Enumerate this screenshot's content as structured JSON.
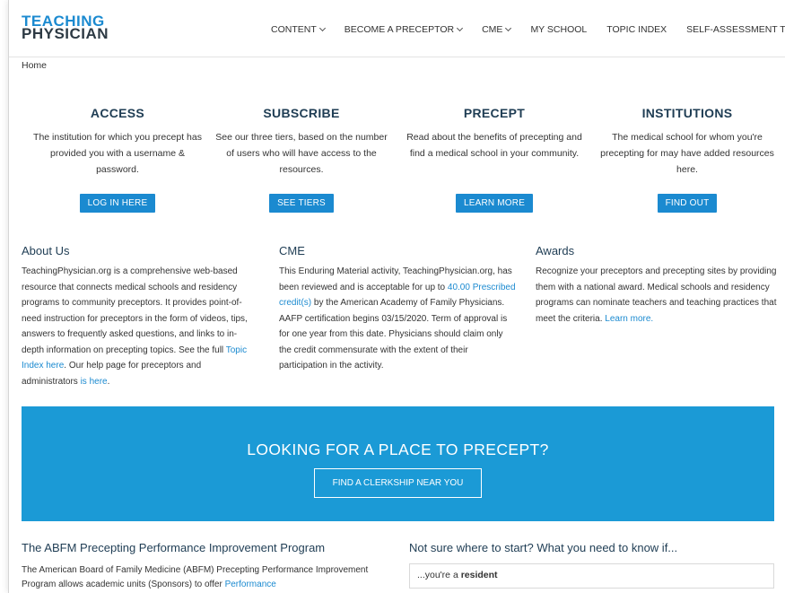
{
  "logo": {
    "line1": "TEACHING",
    "line2": "PHYSICIAN"
  },
  "nav": {
    "items": [
      {
        "label": "CONTENT",
        "dropdown": true
      },
      {
        "label": "BECOME A PRECEPTOR",
        "dropdown": true
      },
      {
        "label": "CME",
        "dropdown": true
      },
      {
        "label": "MY SCHOOL",
        "dropdown": false
      },
      {
        "label": "TOPIC INDEX",
        "dropdown": false
      },
      {
        "label": "SELF-ASSESSMENT TOOL",
        "dropdown": false
      }
    ]
  },
  "breadcrumb": "Home",
  "features": [
    {
      "title": "ACCESS",
      "text": "The institution for which you precept has provided you with a username & password.",
      "button": "LOG IN HERE"
    },
    {
      "title": "SUBSCRIBE",
      "text": "See our three tiers, based on the number of users who will have access to the resources.",
      "button": "SEE TIERS"
    },
    {
      "title": "PRECEPT",
      "text": "Read about the benefits of precepting and find a medical school in your community.",
      "button": "LEARN MORE"
    },
    {
      "title": "INSTITUTIONS",
      "text": "The medical school for whom you're precepting for may have added resources here.",
      "button": "FIND OUT"
    }
  ],
  "about": {
    "title": "About Us",
    "text1": "TeachingPhysician.org is a comprehensive web-based resource that connects medical schools and residency programs to community preceptors. It provides point-of-need instruction for preceptors in the form of videos, tips, answers to frequently asked questions, and links to in-depth information on precepting topics. See the full ",
    "link1": "Topic Index here",
    "text2": ". Our help page for preceptors and administrators ",
    "link2": "is here",
    "text3": "."
  },
  "cme": {
    "title": "CME",
    "text1": "This Enduring Material activity, TeachingPhysician.org, has been reviewed and is acceptable for up to ",
    "link1": "40.00 Prescribed credit(s)",
    "text2": " by the American Academy of Family Physicians. AAFP certification begins 03/15/2020. Term of approval is for one year from this date. Physicians should claim only the credit commensurate with the extent of their participation in the activity."
  },
  "awards": {
    "title": "Awards",
    "text1": "Recognize your preceptors and precepting sites by providing them with a national award. Medical schools and residency programs can nominate teachers and teaching practices that meet the criteria. ",
    "link1": "Learn more."
  },
  "banner": {
    "title": "LOOKING FOR A PLACE TO PRECEPT?",
    "button": "FIND A CLERKSHIP NEAR YOU",
    "color": "#1b9ad6"
  },
  "abfm": {
    "title": "The ABFM Precepting Performance Improvement Program",
    "text1": "The American Board of Family Medicine (ABFM) Precepting Performance Improvement Program allows academic units (Sponsors) to offer ",
    "link1": "Performance"
  },
  "know": {
    "title": "Not sure where to start? What you need to know if...",
    "item_prefix": "...you're a ",
    "item_bold": "resident"
  },
  "colors": {
    "accent": "#1b8ad0",
    "heading": "#1f3d54"
  }
}
